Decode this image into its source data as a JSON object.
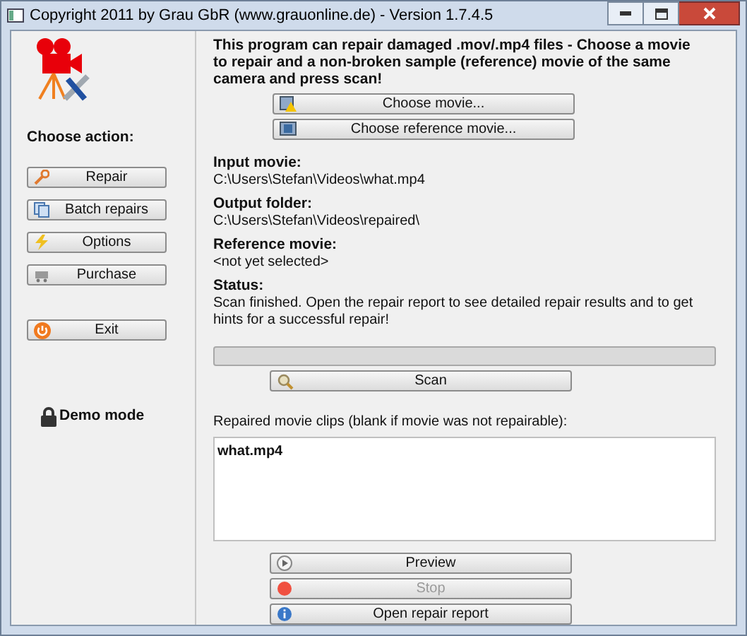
{
  "window": {
    "title": "Copyright 2011 by Grau GbR (www.grauonline.de) - Version 1.7.4.5"
  },
  "sidebar": {
    "heading": "Choose action:",
    "actions": [
      {
        "label": "Repair",
        "kind": "wrench"
      },
      {
        "label": "Batch repairs",
        "kind": "batch"
      },
      {
        "label": "Options",
        "kind": "bolt"
      },
      {
        "label": "Purchase",
        "kind": "cart"
      }
    ],
    "exit": {
      "label": "Exit",
      "kind": "power"
    },
    "mode": "Demo mode"
  },
  "intro": "This program can repair damaged .mov/.mp4 files - Choose a movie to repair and a non-broken sample (reference) movie of the same camera and press scan!",
  "choose_buttons": [
    {
      "label": "Choose movie...",
      "kind": "warn"
    },
    {
      "label": "Choose reference movie...",
      "kind": "film"
    }
  ],
  "fields": [
    {
      "label": "Input movie:",
      "value": "C:\\Users\\Stefan\\Videos\\what.mp4"
    },
    {
      "label": "Output folder:",
      "value": "C:\\Users\\Stefan\\Videos\\repaired\\"
    },
    {
      "label": "Reference movie:",
      "value": "<not yet selected>"
    },
    {
      "label": "Status:",
      "value": "Scan finished. Open the repair report to see detailed repair results and to get hints for a successful repair!"
    }
  ],
  "progress": {
    "level": 0
  },
  "scan_button": "Scan",
  "clips": {
    "label": "Repaired movie clips (blank if movie was not repairable):",
    "items": [
      "what.mp4"
    ]
  },
  "bottom_buttons": [
    {
      "label": "Preview",
      "kind": "play",
      "disabled": false
    },
    {
      "label": "Stop",
      "kind": "stop",
      "disabled": true
    },
    {
      "label": "Open repair report",
      "kind": "info",
      "disabled": false
    }
  ]
}
